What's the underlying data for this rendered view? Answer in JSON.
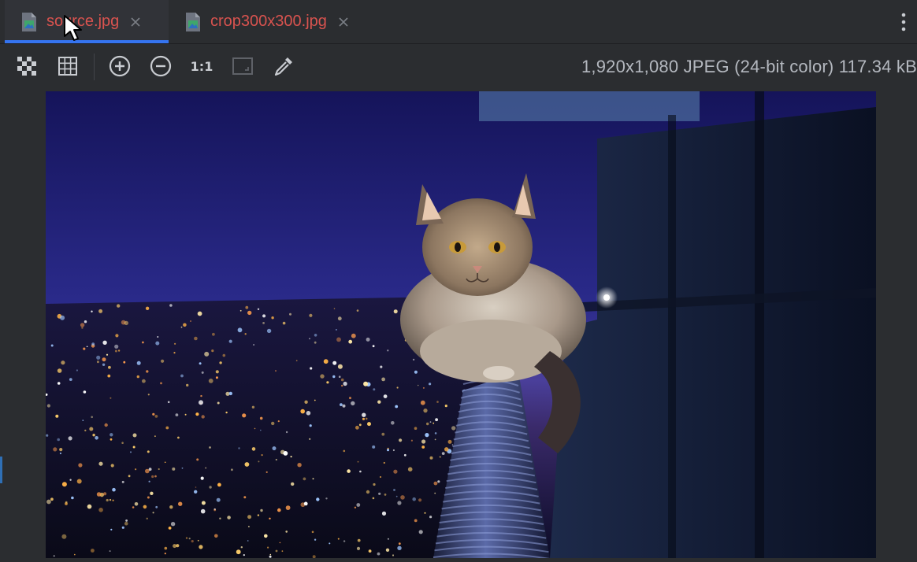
{
  "tabs": [
    {
      "label": "source.jpg",
      "active": true
    },
    {
      "label": "crop300x300.jpg",
      "active": false
    }
  ],
  "toolbar": {
    "buttons": [
      {
        "name": "transparency-chessboard-icon"
      },
      {
        "name": "grid-icon"
      },
      {
        "name": "zoom-in-icon"
      },
      {
        "name": "zoom-out-icon"
      },
      {
        "name": "actual-size-icon",
        "label": "1:1"
      },
      {
        "name": "fit-zoom-icon"
      },
      {
        "name": "color-picker-icon"
      }
    ],
    "image_info": "1,920x1,080 JPEG (24-bit color) 117.34 kB"
  },
  "colors": {
    "background": "#2b2d30",
    "tab_label": "#d9534f",
    "accent": "#3574f0",
    "info_text": "#b4b8bf"
  }
}
